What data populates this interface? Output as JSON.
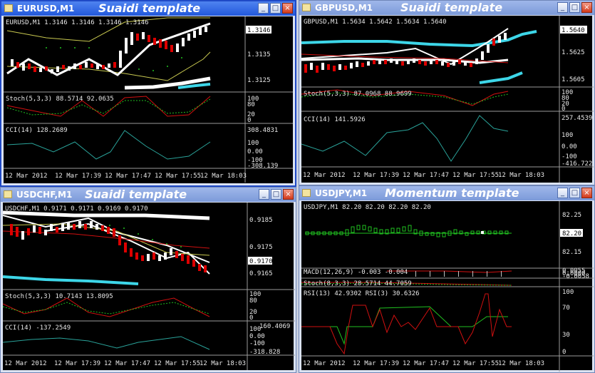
{
  "windows": [
    {
      "id": "eurusd",
      "title": "EURUSD,M1",
      "template": "Suaidi template",
      "active": true,
      "price_info": "EURUSD,M1  1.3146 1.3146 1.3146 1.3146",
      "current_price": "1.3146",
      "price_axis": [
        "1.3146",
        "1.3135",
        "1.3125"
      ],
      "indicators": [
        {
          "label": "Stoch(5,3,3) 88.5714 92.0635",
          "axis": [
            "100",
            "80",
            "20",
            "0"
          ]
        },
        {
          "label": "CCI(14) 128.2689",
          "axis": [
            "308.4831",
            "100",
            "0.00",
            "-100",
            "-308.139"
          ]
        }
      ],
      "time_axis": [
        "12 Mar 2012",
        "12 Mar 17:39",
        "12 Mar 17:47",
        "12 Mar 17:55",
        "12 Mar 18:03"
      ]
    },
    {
      "id": "gbpusd",
      "title": "GBPUSD,M1",
      "template": "Suaidi template",
      "active": false,
      "price_info": "GBPUSD,M1  1.5634 1.5642 1.5634 1.5640",
      "current_price": "1.5640",
      "price_axis": [
        "1.5640",
        "1.5625",
        "1.5605"
      ],
      "indicators": [
        {
          "label": "Stoch(5,3,3) 87.0968 88.9699",
          "axis": [
            "100",
            "80",
            "20",
            "0"
          ]
        },
        {
          "label": "CCI(14) 141.5926",
          "axis": [
            "257.4539",
            "100",
            "0.00",
            "-100",
            "-416.722"
          ]
        }
      ],
      "time_axis": [
        "12 Mar 2012",
        "12 Mar 17:39",
        "12 Mar 17:47",
        "12 Mar 17:55",
        "12 Mar 18:03"
      ]
    },
    {
      "id": "usdchf",
      "title": "USDCHF,M1",
      "template": "Suaidi template",
      "active": false,
      "price_info": "USDCHF,M1  0.9171 0.9171 0.9169 0.9170",
      "current_price": "0.9170",
      "price_axis": [
        "0.9185",
        "0.9175",
        "0.9165"
      ],
      "indicators": [
        {
          "label": "Stoch(5,3,3) 10.7143 13.8095",
          "axis": [
            "100",
            "80",
            "20",
            "0"
          ]
        },
        {
          "label": "CCI(14) -137.2549",
          "axis": [
            "160.4069",
            "100",
            "0.00",
            "-100",
            "-318.828"
          ]
        }
      ],
      "time_axis": [
        "12 Mar 2012",
        "12 Mar 17:39",
        "12 Mar 17:47",
        "12 Mar 17:55",
        "12 Mar 18:03"
      ]
    },
    {
      "id": "usdjpy",
      "title": "USDJPY,M1",
      "template": "Momentum template",
      "active": false,
      "price_info": "USDJPY,M1  82.20 82.20 82.20 82.20",
      "current_price": "82.20",
      "price_axis": [
        "82.25",
        "82.15"
      ],
      "indicators": [
        {
          "label": "MACD(12,26,9) -0.003 -0.004",
          "axis": [
            "0.0055",
            "0.0000",
            "-0.0058"
          ]
        },
        {
          "label": "Stoch(8,3,3) 28.5714 44.7059",
          "axis": []
        },
        {
          "label": "RSI(13) 42.9302  RSI(3) 30.6326",
          "axis": [
            "100",
            "70",
            "30",
            "0"
          ]
        }
      ],
      "time_axis": [
        "12 Mar 2012",
        "12 Mar 17:39",
        "12 Mar 17:47",
        "12 Mar 17:55",
        "12 Mar 18:03"
      ]
    }
  ],
  "window_buttons": {
    "minimize": "_",
    "maximize": "□",
    "close": "×"
  },
  "colors": {
    "chart_bg": "#000000",
    "bull_candle": "#ffffff",
    "bear_candle": "#dd0000",
    "band_cyan": "#3dd6e8",
    "signal_red": "#d01010",
    "indicator_green": "#20c020",
    "cci_line": "#2aa39a",
    "band_yellow": "#c8c850"
  }
}
